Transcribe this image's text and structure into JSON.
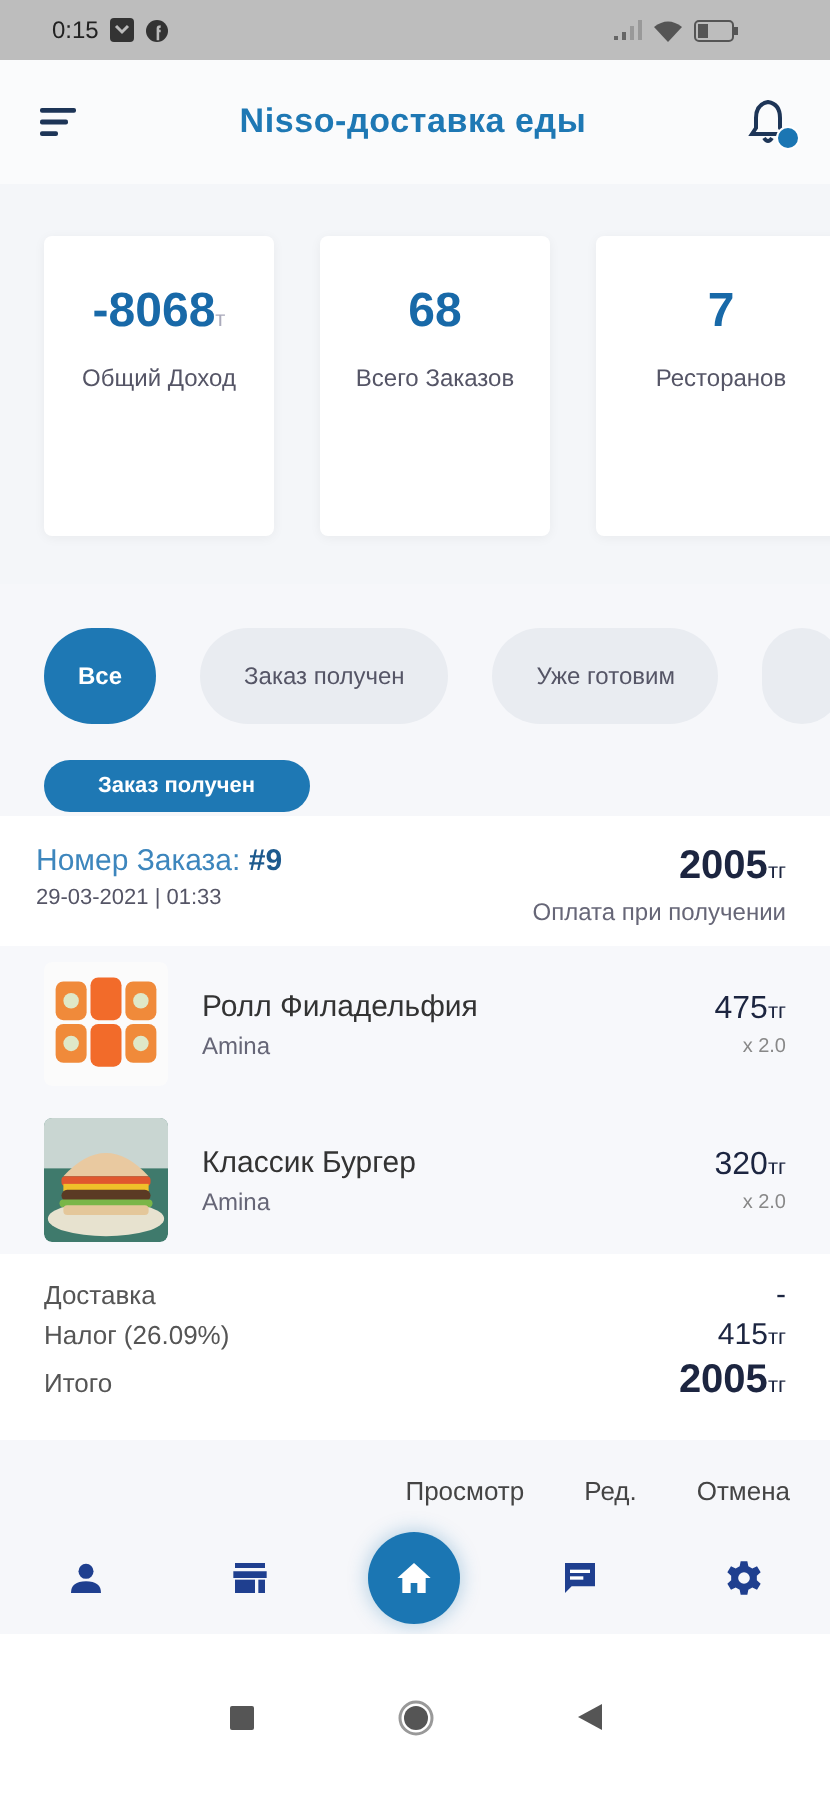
{
  "status_bar": {
    "time": "0:15"
  },
  "app_bar": {
    "title": "Nisso-доставка еды",
    "notification_badge": true
  },
  "stats": [
    {
      "value": "-8068",
      "unit": "т",
      "label": "Общий Доход"
    },
    {
      "value": "68",
      "label": "Всего Заказов"
    },
    {
      "value": "7",
      "label": "Ресторанов"
    }
  ],
  "filters": [
    {
      "label": "Все",
      "selected": true
    },
    {
      "label": "Заказ получен",
      "selected": false
    },
    {
      "label": "Уже готовим",
      "selected": false
    }
  ],
  "order": {
    "status": "Заказ получен",
    "number_label": "Номер Заказа: ",
    "number": "#9",
    "datetime": "29-03-2021 | 01:33",
    "total": "2005",
    "total_unit": "тг",
    "payment": "Оплата при получении",
    "items": [
      {
        "name": "Ролл Филадельфия",
        "restaurant": "Amina",
        "price": "475",
        "unit": "тг",
        "qty": "x 2.0"
      },
      {
        "name": "Классик Бургер",
        "restaurant": "Amina",
        "price": "320",
        "unit": "тг",
        "qty": "x 2.0"
      }
    ],
    "summary": [
      {
        "label": "Доставка",
        "value": "-"
      },
      {
        "label": "Налог (26.09%)",
        "value": "415",
        "unit": "тг"
      },
      {
        "label": "Итого",
        "value": "2005",
        "unit": "тг",
        "kind": "total"
      }
    ],
    "actions": [
      "Просмотр",
      "Ред.",
      "Отмена"
    ]
  },
  "nav": [
    {
      "selected": false
    },
    {
      "selected": false
    },
    {
      "selected": true
    },
    {
      "selected": false
    },
    {
      "selected": false
    }
  ]
}
